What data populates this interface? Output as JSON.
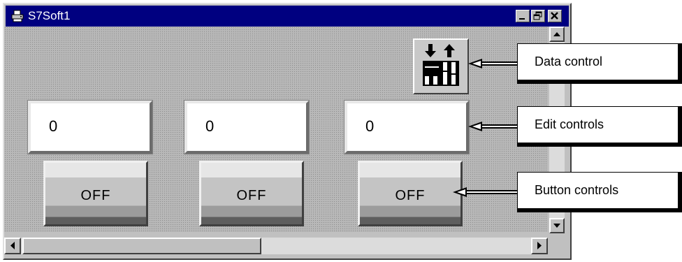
{
  "window": {
    "title": "S7Soft1",
    "icon": "printer-icon",
    "controls": [
      "minimize",
      "restore",
      "close"
    ]
  },
  "data_control": {
    "icon": "data-transfer-icon"
  },
  "edit_controls": [
    {
      "value": "0"
    },
    {
      "value": "0"
    },
    {
      "value": "0"
    }
  ],
  "button_controls": [
    {
      "label": "OFF"
    },
    {
      "label": "OFF"
    },
    {
      "label": "OFF"
    }
  ],
  "callouts": {
    "data_control": "Data control",
    "edit_controls": "Edit controls",
    "button_controls": "Button controls"
  },
  "colors": {
    "titlebar": "#000080",
    "client": "#b8b8b8",
    "face": "#c0c0c0"
  }
}
